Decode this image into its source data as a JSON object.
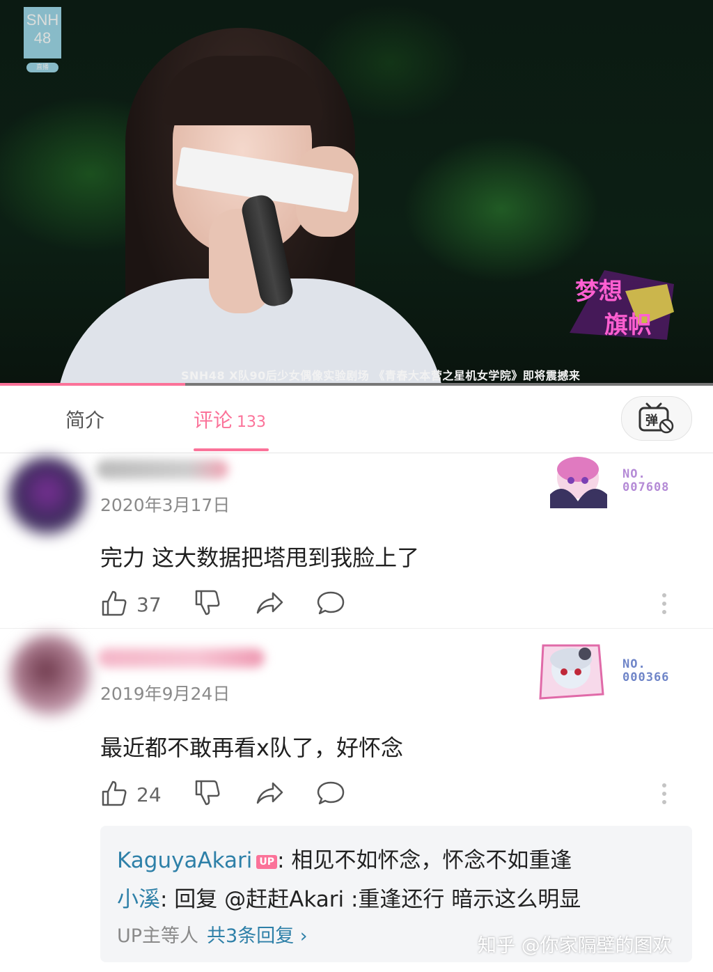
{
  "video": {
    "logo_line1": "SNH",
    "logo_line2": "48",
    "logo_sub": "直播",
    "ticker": "SNH48 X队90后少女偶像实验剧场 《青春大本营之星机女学院》即将震撼来",
    "progress": 0.26,
    "show_logo_line1": "梦想",
    "show_logo_line2": "旗帜",
    "accent_color": "#fb7299"
  },
  "tabs": {
    "intro_label": "简介",
    "comments_label": "评论",
    "comments_count": "133",
    "danmaku_icon": "danmaku-off-icon"
  },
  "comments": [
    {
      "date": "2020年3月17日",
      "text": "完力 这大数据把塔甩到我脸上了",
      "likes": "37",
      "badge_label": "NO.",
      "badge_number": "007608"
    },
    {
      "date": "2019年9月24日",
      "text": "最近都不敢再看x队了，好怀念",
      "likes": "24",
      "badge_label": "NO.",
      "badge_number": "000366",
      "replies": [
        {
          "name": "KaguyaAkari",
          "tag": "UP",
          "sep": ":",
          "text": " 相见不如怀念，怀念不如重逢"
        },
        {
          "name": "小溪",
          "sep": ":",
          "text": " 回复 @赶赶Akari :重逢还行 暗示这么明显"
        }
      ],
      "reply_more_prefix": "UP主等人",
      "reply_more_link": "共3条回复 ›"
    }
  ],
  "watermark": "知乎 @你家隔壁的图欢"
}
